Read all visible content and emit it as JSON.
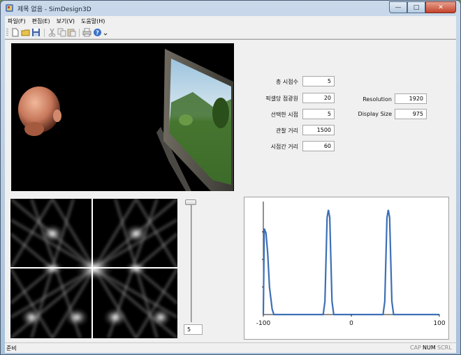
{
  "window": {
    "title": "제목 없음 - SimDesign3D",
    "buttons": {
      "minimize": "—",
      "maximize": "□",
      "close": "✕"
    }
  },
  "menu": [
    {
      "label": "파일(F)"
    },
    {
      "label": "편집(E)"
    },
    {
      "label": "보기(V)"
    },
    {
      "label": "도움말(H)"
    }
  ],
  "toolbar": [
    "new-file-icon",
    "open-folder-icon",
    "save-icon",
    "cut-icon",
    "copy-icon",
    "paste-icon",
    "print-icon",
    "help-icon"
  ],
  "params": {
    "total_views": {
      "label": "총 시점수",
      "value": "5"
    },
    "subpixel": {
      "label": "픽셀당 점광원",
      "value": "20"
    },
    "selected_view": {
      "label": "선택한 시점",
      "value": "5"
    },
    "viewing_distance": {
      "label": "관찰 거리",
      "value": "1500"
    },
    "view_spacing": {
      "label": "시점간 거리",
      "value": "60"
    },
    "resolution": {
      "label": "Resolution",
      "value": "1920"
    },
    "display_size": {
      "label": "Display Size",
      "value": "975"
    }
  },
  "slider": {
    "value": "5",
    "level": 0.0
  },
  "status": {
    "text": "준비",
    "indicators": [
      {
        "label": "CAP",
        "active": false
      },
      {
        "label": "NUM",
        "active": true
      },
      {
        "label": "SCRL",
        "active": false
      }
    ]
  },
  "chart_data": {
    "type": "line",
    "xlim": [
      -100,
      100
    ],
    "ylim": [
      0,
      1
    ],
    "xticks": [
      "-100",
      "0",
      "100"
    ],
    "line_color": "#3d6fb6",
    "series": [
      {
        "x": [
          -100,
          -99,
          -97,
          -95,
          -93,
          -90,
          -88,
          -80,
          -60,
          -55,
          -45,
          -32,
          -31,
          -30,
          -28,
          -26,
          -20,
          -13,
          -10,
          10,
          13,
          20,
          36,
          37,
          38,
          40,
          42,
          48,
          56,
          58,
          100
        ],
        "y": [
          0.0,
          0.78,
          0.74,
          0.55,
          0.25,
          0.05,
          0.0,
          0.0,
          0.0,
          0.0,
          0.0,
          0.0,
          0.0,
          0.0,
          0.0,
          0.0,
          0.0,
          0.0,
          0.0,
          0.0,
          0.0,
          0.0,
          0.0,
          0.0,
          0.0,
          0.0,
          0.0,
          0.0,
          0.0,
          0.0,
          0.0
        ]
      }
    ]
  }
}
